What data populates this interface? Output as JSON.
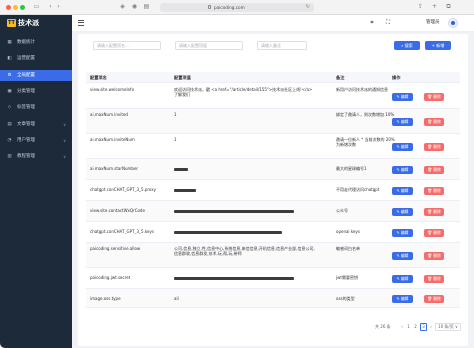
{
  "browser": {
    "url": "paicoding.com"
  },
  "brand": {
    "name": "技术派",
    "mark": "TT"
  },
  "sidebar": {
    "items": [
      {
        "label": "数据统计",
        "icon": "chart-icon",
        "arrow": ""
      },
      {
        "label": "运营配置",
        "icon": "cube-icon",
        "arrow": ""
      },
      {
        "label": "全局配置",
        "icon": "gear-icon",
        "arrow": ""
      },
      {
        "label": "分类管理",
        "icon": "category-icon",
        "arrow": ""
      },
      {
        "label": "标签管理",
        "icon": "tag-icon",
        "arrow": ""
      },
      {
        "label": "文章管理",
        "icon": "document-icon",
        "arrow": "∨"
      },
      {
        "label": "用户管理",
        "icon": "user-icon",
        "arrow": "∨"
      },
      {
        "label": "教程管理",
        "icon": "book-icon",
        "arrow": "∨"
      }
    ],
    "active_index": 2
  },
  "header": {
    "admin_label": "管理员"
  },
  "filters": {
    "key_placeholder": "请输入配置项名...",
    "value_placeholder": "请输入配置项值",
    "note_placeholder": "请输入备注",
    "search_label": "搜索",
    "add_label": "新增"
  },
  "table": {
    "columns": [
      "配置项名",
      "配置项值",
      "备注",
      "操作"
    ],
    "edit_label": "编辑",
    "delete_label": "删除",
    "rows": [
      {
        "name": "view.site.welcomeInfo",
        "value": "欢迎访问技术派，戳 <a href=\"/article/detail/155\">技术派社区上线!</a> 了解我们",
        "note": "新用户访问技术派的通知信息"
      },
      {
        "name": "ai.maxNum.invited",
        "value": "1",
        "note": "绑定了邀请人，则次数增加 10%"
      },
      {
        "name": "ai.maxNum.inviteNum",
        "value": "1",
        "note": "邀请一位新人 * 当前次数的 20% 为新增次数"
      },
      {
        "name": "ai.maxNum.starNumber",
        "value": "",
        "note": "最大的星球编号1"
      },
      {
        "name": "chatgpt.conCHAT_GPT_3_5.proxy",
        "value": "",
        "note": "不用走代理访问chatgpt"
      },
      {
        "name": "view.site.contactWxQrCode",
        "value": "",
        "note": "公众号"
      },
      {
        "name": "chatgpt.conCHAT_GPT_3_5.keys",
        "value": "",
        "note": "openai keys"
      },
      {
        "name": "paicoding.sensitive.allow",
        "value": "公司,信息,独立,性,信息中心,系统信息,来信信息,开机信息,信息产业部,信息公司,信息群收,信息群发,技术,玩,帮,玩,带师",
        "note": "敏感词白名单"
      },
      {
        "name": "paicoding.jwt.secret",
        "value": "",
        "note": "jwt需要密钥"
      },
      {
        "name": "image.oss.type",
        "value": "ali",
        "note": "oss的类型"
      }
    ]
  },
  "pagination": {
    "total_label": "共 26 条",
    "pages": [
      "1",
      "2",
      "3"
    ],
    "current": "3",
    "prev": "‹",
    "next": "›",
    "page_size_label": "10 条/页 ∨"
  }
}
